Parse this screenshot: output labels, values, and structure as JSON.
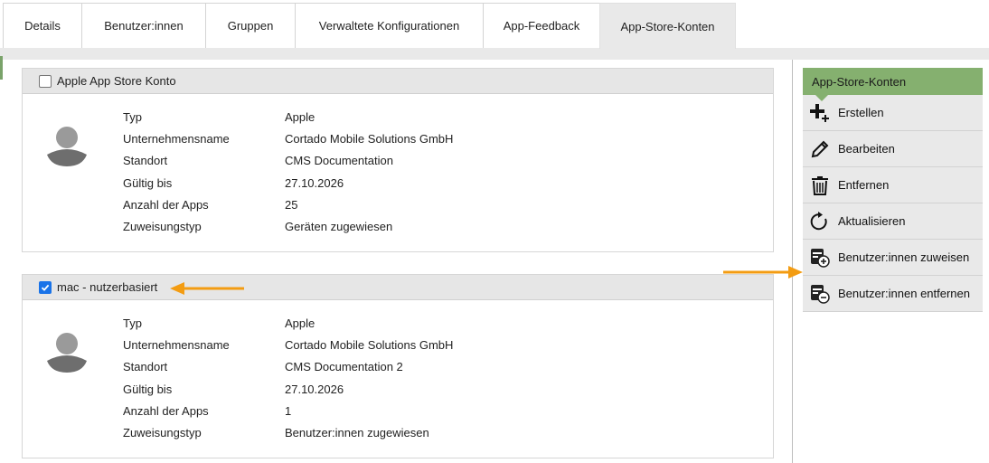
{
  "tabs": [
    {
      "label": "Details",
      "active": false
    },
    {
      "label": "Benutzer:innen",
      "active": false
    },
    {
      "label": "Gruppen",
      "active": false
    },
    {
      "label": "Verwaltete Konfigurationen",
      "active": false
    },
    {
      "label": "App-Feedback",
      "active": false
    },
    {
      "label": "App-Store-Konten",
      "active": true
    }
  ],
  "accounts": [
    {
      "title": "Apple App Store Konto",
      "checked": false,
      "fields": [
        {
          "label": "Typ",
          "value": "Apple"
        },
        {
          "label": "Unternehmensname",
          "value": "Cortado Mobile Solutions GmbH"
        },
        {
          "label": "Standort",
          "value": "CMS Documentation"
        },
        {
          "label": "Gültig bis",
          "value": "27.10.2026"
        },
        {
          "label": "Anzahl der Apps",
          "value": "25"
        },
        {
          "label": "Zuweisungstyp",
          "value": "Geräten zugewiesen"
        }
      ]
    },
    {
      "title": "mac - nutzerbasiert",
      "checked": true,
      "fields": [
        {
          "label": "Typ",
          "value": "Apple"
        },
        {
          "label": "Unternehmensname",
          "value": "Cortado Mobile Solutions GmbH"
        },
        {
          "label": "Standort",
          "value": "CMS Documentation 2"
        },
        {
          "label": "Gültig bis",
          "value": "27.10.2026"
        },
        {
          "label": "Anzahl der Apps",
          "value": "1"
        },
        {
          "label": "Zuweisungstyp",
          "value": "Benutzer:innen zugewiesen"
        }
      ]
    }
  ],
  "sidebar": {
    "title": "App-Store-Konten",
    "items": [
      {
        "label": "Erstellen",
        "icon": "plus-icon"
      },
      {
        "label": "Bearbeiten",
        "icon": "pencil-icon"
      },
      {
        "label": "Entfernen",
        "icon": "trash-icon"
      },
      {
        "label": "Aktualisieren",
        "icon": "refresh-icon"
      },
      {
        "label": "Benutzer:innen zuweisen",
        "icon": "assign-users-icon"
      },
      {
        "label": "Benutzer:innen entfernen",
        "icon": "remove-users-icon"
      }
    ]
  },
  "colors": {
    "accent_green": "#85b06f",
    "annotation_arrow": "#f39c12",
    "checkbox_blue": "#1a73e8"
  }
}
